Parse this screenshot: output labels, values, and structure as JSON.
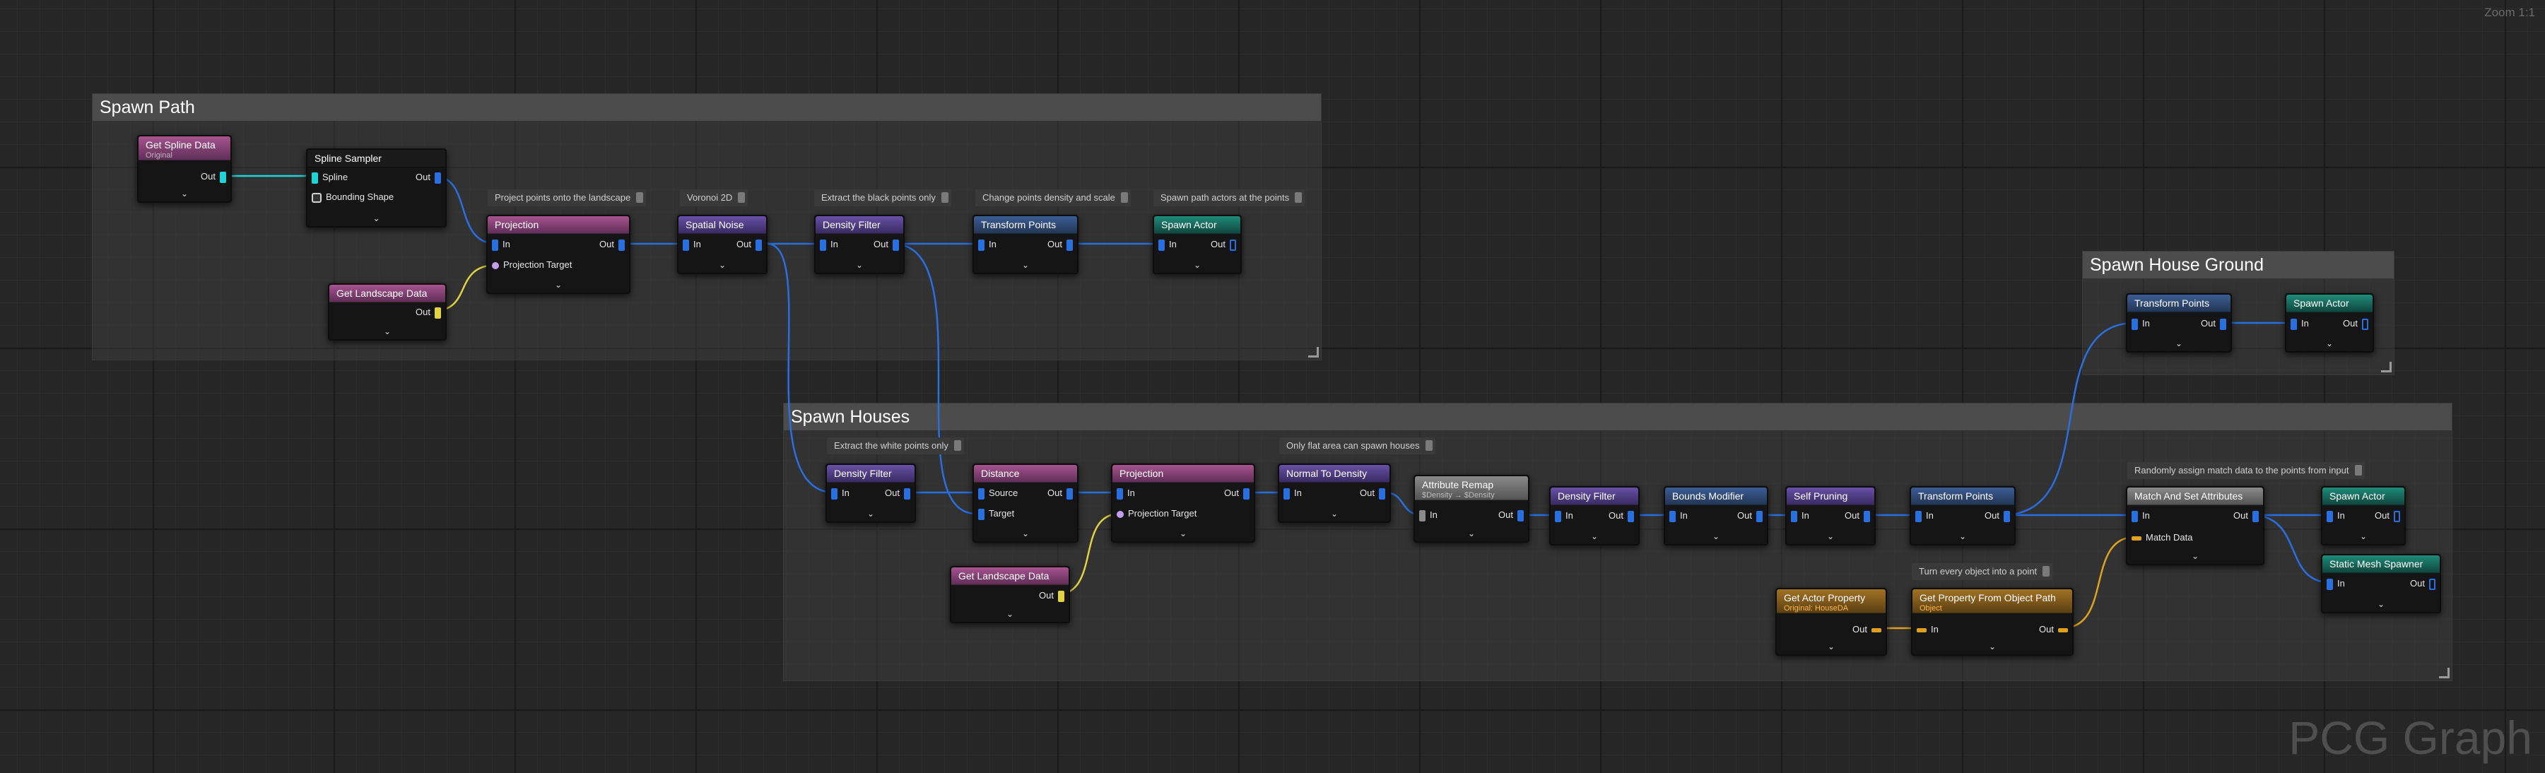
{
  "viewport": {
    "zoom_label": "Zoom 1:1",
    "watermark": "PCG Graph"
  },
  "groups": {
    "spawn_path": "Spawn Path",
    "spawn_houses": "Spawn Houses",
    "spawn_house_ground": "Spawn House Ground"
  },
  "comments": {
    "c1": "Project points onto the landscape",
    "c2": "Voronoi 2D",
    "c3": "Extract the black points only",
    "c4": "Change points density and scale",
    "c5": "Spawn path actors at the points",
    "c6": "Extract the white points only",
    "c7": "Only flat area can spawn houses",
    "c8": "Randomly assign match data to the points from input",
    "c9": "Turn every object into a point"
  },
  "pins": {
    "in": "In",
    "out": "Out",
    "spline": "Spline",
    "bounding_shape": "Bounding Shape",
    "projection_target": "Projection Target",
    "source": "Source",
    "target": "Target",
    "match_data": "Match Data"
  },
  "nodes": {
    "get_spline_data": {
      "title": "Get Spline Data",
      "sub": "Original"
    },
    "spline_sampler": {
      "title": "Spline Sampler"
    },
    "get_landscape_data_1": {
      "title": "Get Landscape Data"
    },
    "projection_1": {
      "title": "Projection"
    },
    "spatial_noise": {
      "title": "Spatial Noise"
    },
    "density_filter_1": {
      "title": "Density Filter"
    },
    "transform_points_1": {
      "title": "Transform Points"
    },
    "spawn_actor_1": {
      "title": "Spawn Actor"
    },
    "transform_points_ground": {
      "title": "Transform Points"
    },
    "spawn_actor_ground": {
      "title": "Spawn Actor"
    },
    "density_filter_2": {
      "title": "Density Filter"
    },
    "distance": {
      "title": "Distance"
    },
    "projection_2": {
      "title": "Projection"
    },
    "normal_to_density": {
      "title": "Normal To Density"
    },
    "attribute_remap": {
      "title": "Attribute Remap",
      "sub": "$Density → $Density"
    },
    "density_filter_3": {
      "title": "Density Filter"
    },
    "bounds_modifier": {
      "title": "Bounds Modifier"
    },
    "self_pruning": {
      "title": "Self Pruning"
    },
    "transform_points_2": {
      "title": "Transform Points"
    },
    "match_and_set": {
      "title": "Match And Set Attributes"
    },
    "spawn_actor_2": {
      "title": "Spawn Actor"
    },
    "static_mesh_spawner": {
      "title": "Static Mesh Spawner"
    },
    "get_landscape_data_2": {
      "title": "Get Landscape Data"
    },
    "get_actor_property": {
      "title": "Get Actor Property",
      "sub": "Original: HouseDA"
    },
    "get_property_from_path": {
      "title": "Get Property From Object Path",
      "sub": "Object"
    }
  },
  "colors": {
    "pin_point": "#2a6fe0",
    "pin_spline": "#1ed4d8",
    "pin_landscape": "#e0d240",
    "pin_object": "#e0a120"
  }
}
